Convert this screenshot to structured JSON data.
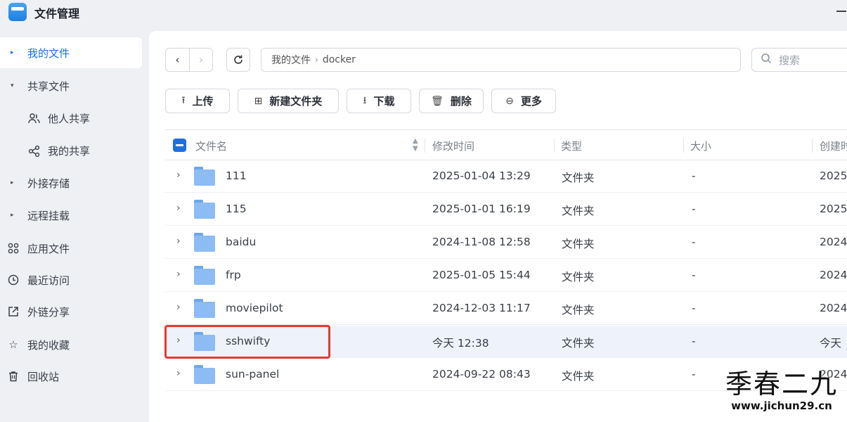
{
  "app": {
    "title": "文件管理"
  },
  "sidebar": {
    "items": [
      {
        "label": "我的文件"
      },
      {
        "label": "共享文件"
      },
      {
        "label": "他人共享"
      },
      {
        "label": "我的共享"
      },
      {
        "label": "外接存储"
      },
      {
        "label": "远程挂载"
      },
      {
        "label": "应用文件"
      },
      {
        "label": "最近访问"
      },
      {
        "label": "外链分享"
      },
      {
        "label": "我的收藏"
      },
      {
        "label": "回收站"
      }
    ]
  },
  "path": {
    "root": "我的文件",
    "current": "docker"
  },
  "search": {
    "placeholder": "搜索"
  },
  "toolbar": {
    "upload": "上传",
    "new_folder": "新建文件夹",
    "download": "下载",
    "delete": "删除",
    "more": "更多"
  },
  "table": {
    "columns": {
      "name": "文件名",
      "modified": "修改时间",
      "type": "类型",
      "size": "大小",
      "created": "创建时"
    },
    "rows": [
      {
        "name": "111",
        "modified": "2025-01-04 13:29",
        "type": "文件夹",
        "size": "-",
        "created": "2025"
      },
      {
        "name": "115",
        "modified": "2025-01-01 16:19",
        "type": "文件夹",
        "size": "-",
        "created": "2025"
      },
      {
        "name": "baidu",
        "modified": "2024-11-08 12:58",
        "type": "文件夹",
        "size": "-",
        "created": "2024"
      },
      {
        "name": "frp",
        "modified": "2025-01-05 15:44",
        "type": "文件夹",
        "size": "-",
        "created": "2024"
      },
      {
        "name": "moviepilot",
        "modified": "2024-12-03 11:17",
        "type": "文件夹",
        "size": "-",
        "created": "2024"
      },
      {
        "name": "sshwifty",
        "modified": "今天 12:38",
        "type": "文件夹",
        "size": "-",
        "created": "今天"
      },
      {
        "name": "sun-panel",
        "modified": "2024-09-22 08:43",
        "type": "文件夹",
        "size": "-",
        "created": "2024"
      }
    ]
  },
  "watermark": {
    "title": "季春二九",
    "url": "www.jichun29.cn"
  },
  "colors": {
    "accent": "#1e6fe0",
    "folder": "#8cbcf3",
    "highlight": "#e53935"
  }
}
